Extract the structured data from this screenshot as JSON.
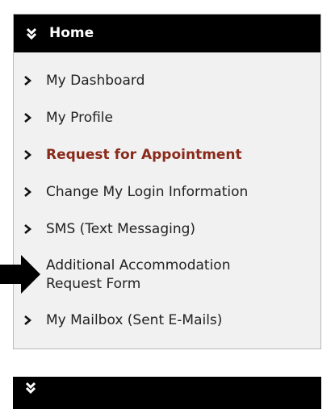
{
  "section": {
    "title": "Home",
    "items": [
      {
        "label": "My Dashboard"
      },
      {
        "label": "My Profile"
      },
      {
        "label": "Request for Appointment",
        "active": true
      },
      {
        "label": "Change My Login Information"
      },
      {
        "label": "SMS (Text Messaging)"
      },
      {
        "label": "Additional Accommodation Request Form"
      },
      {
        "label": "My Mailbox (Sent E-Mails)"
      }
    ]
  },
  "colors": {
    "header_bg": "#000000",
    "header_text": "#ffffff",
    "panel_bg": "#f1f1f1",
    "active_item": "#8a2a1a"
  },
  "icons": {
    "header": "double-chevron-down-icon",
    "item": "chevron-right-icon",
    "annotation": "pointer-arrow-icon"
  }
}
